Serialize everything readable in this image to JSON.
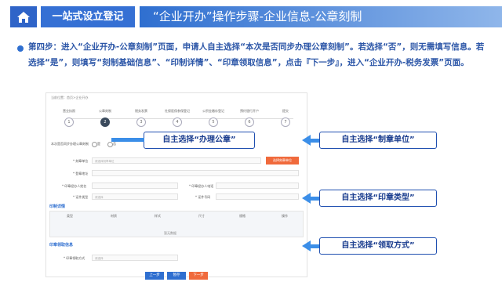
{
  "header": {
    "nav_label": "一站式设立登记",
    "title": "“企业开办”操作步骤-企业信息-公章刻制"
  },
  "instruction": "第四步：进入“企业开办-公章刻制”页面，申请人自主选择“本次是否同步办理公章刻制”。若选择“否”，则无需填写信息。若选择“是”，则填写“刻制基础信息”、“印制详情”、“印章领取信息”，点击『下一步』，进入“企业开办-税务发票”页面。",
  "screenshot": {
    "breadcrumb": "当前位置：首页>企业开办",
    "steps": [
      {
        "label": "营业执照",
        "num": "1"
      },
      {
        "label": "公章刻制",
        "num": "2"
      },
      {
        "label": "税务发票",
        "num": "3"
      },
      {
        "label": "社保医保参保登记",
        "num": "4"
      },
      {
        "label": "公积金缴存登记",
        "num": "5"
      },
      {
        "label": "预约银行开户",
        "num": "6"
      },
      {
        "label": "提交",
        "num": "7"
      }
    ],
    "sync_question": "本次是否同步办理公章刻制",
    "radio_yes": "是",
    "radio_no": "否",
    "field_unit": "* 刻章单位",
    "field_unit_placeholder": "请选择刻章单位",
    "select_unit_button": "选择刻章单位",
    "field_address": "* 登章地址",
    "field_contact": "* 印章经办人姓名",
    "field_contact_phone": "* 印章经办人电话",
    "field_id_type": "* 证件类型",
    "field_id_type_value": "请选择",
    "field_id_no": "* 证件号码",
    "section_detail": "印制详情",
    "table_headers": [
      "类型",
      "材质",
      "样式",
      "尺寸",
      "规格",
      "操作"
    ],
    "table_empty": "暂无数据",
    "section_pickup": "印章领取信息",
    "field_pickup": "* 印章领取方式",
    "field_pickup_value": "请选择",
    "btn_prev": "上一步",
    "btn_save": "暂存",
    "btn_next": "下一步"
  },
  "callouts": {
    "c1": "自主选择“办理公章”",
    "c2": "自主选择“制章单位”",
    "c3": "自主选择“印章类型”",
    "c4": "自主选择“领取方式”"
  }
}
